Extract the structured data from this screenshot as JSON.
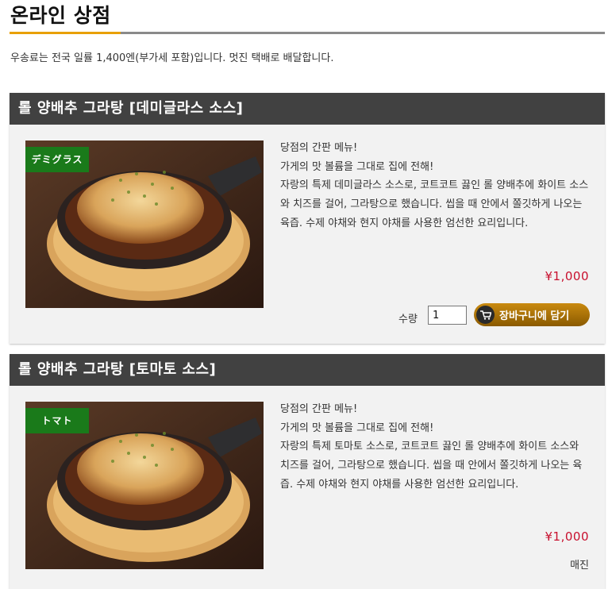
{
  "header": {
    "title": "온라인 상점",
    "shipping_note": "우송료는 전국 일률 1,400엔(부가세 포함)입니다. 멋진 택배로 배달합니다."
  },
  "products": [
    {
      "title": "롤 양배추 그라탕 [데미글라스 소스]",
      "tag": "デミグラス",
      "description": "당점의 간판 메뉴!\n가게의 맛 볼륨을 그대로 집에 전해!\n자랑의 특제 데미글라스 소스로, 코트코트 끓인 롤 양배추에 화이트 소스와 치즈를 걸어, 그라탕으로 했습니다. 씹을 때 안에서 쫄깃하게 나오는 육즙. 수제 야채와 현지 야채를 사용한 엄선한 요리입니다.",
      "price": "¥1,000",
      "qty_label": "수량",
      "qty_value": "1",
      "cart_label": "장바구니에 담기"
    },
    {
      "title": "롤 양배추 그라탕 [토마토 소스]",
      "tag": "トマト",
      "description": "당점의 간판 메뉴!\n가게의 맛 볼륨을 그대로 집에 전해!\n자랑의 특제 토마토 소스로, 코트코트 끓인 롤 양배추에 화이트 소스와 치즈를 걸어, 그라탕으로 했습니다. 씹을 때 안에서 쫄깃하게 나오는 육즙. 수제 야채와 현지 야채를 사용한 엄선한 요리입니다.",
      "price": "¥1,000",
      "status": "매진"
    }
  ],
  "colors": {
    "accent": "#e8a000",
    "header_bar": "#414141",
    "price": "#c8102e",
    "tag_bg": "#1a7a1a",
    "button": "#a87000"
  }
}
